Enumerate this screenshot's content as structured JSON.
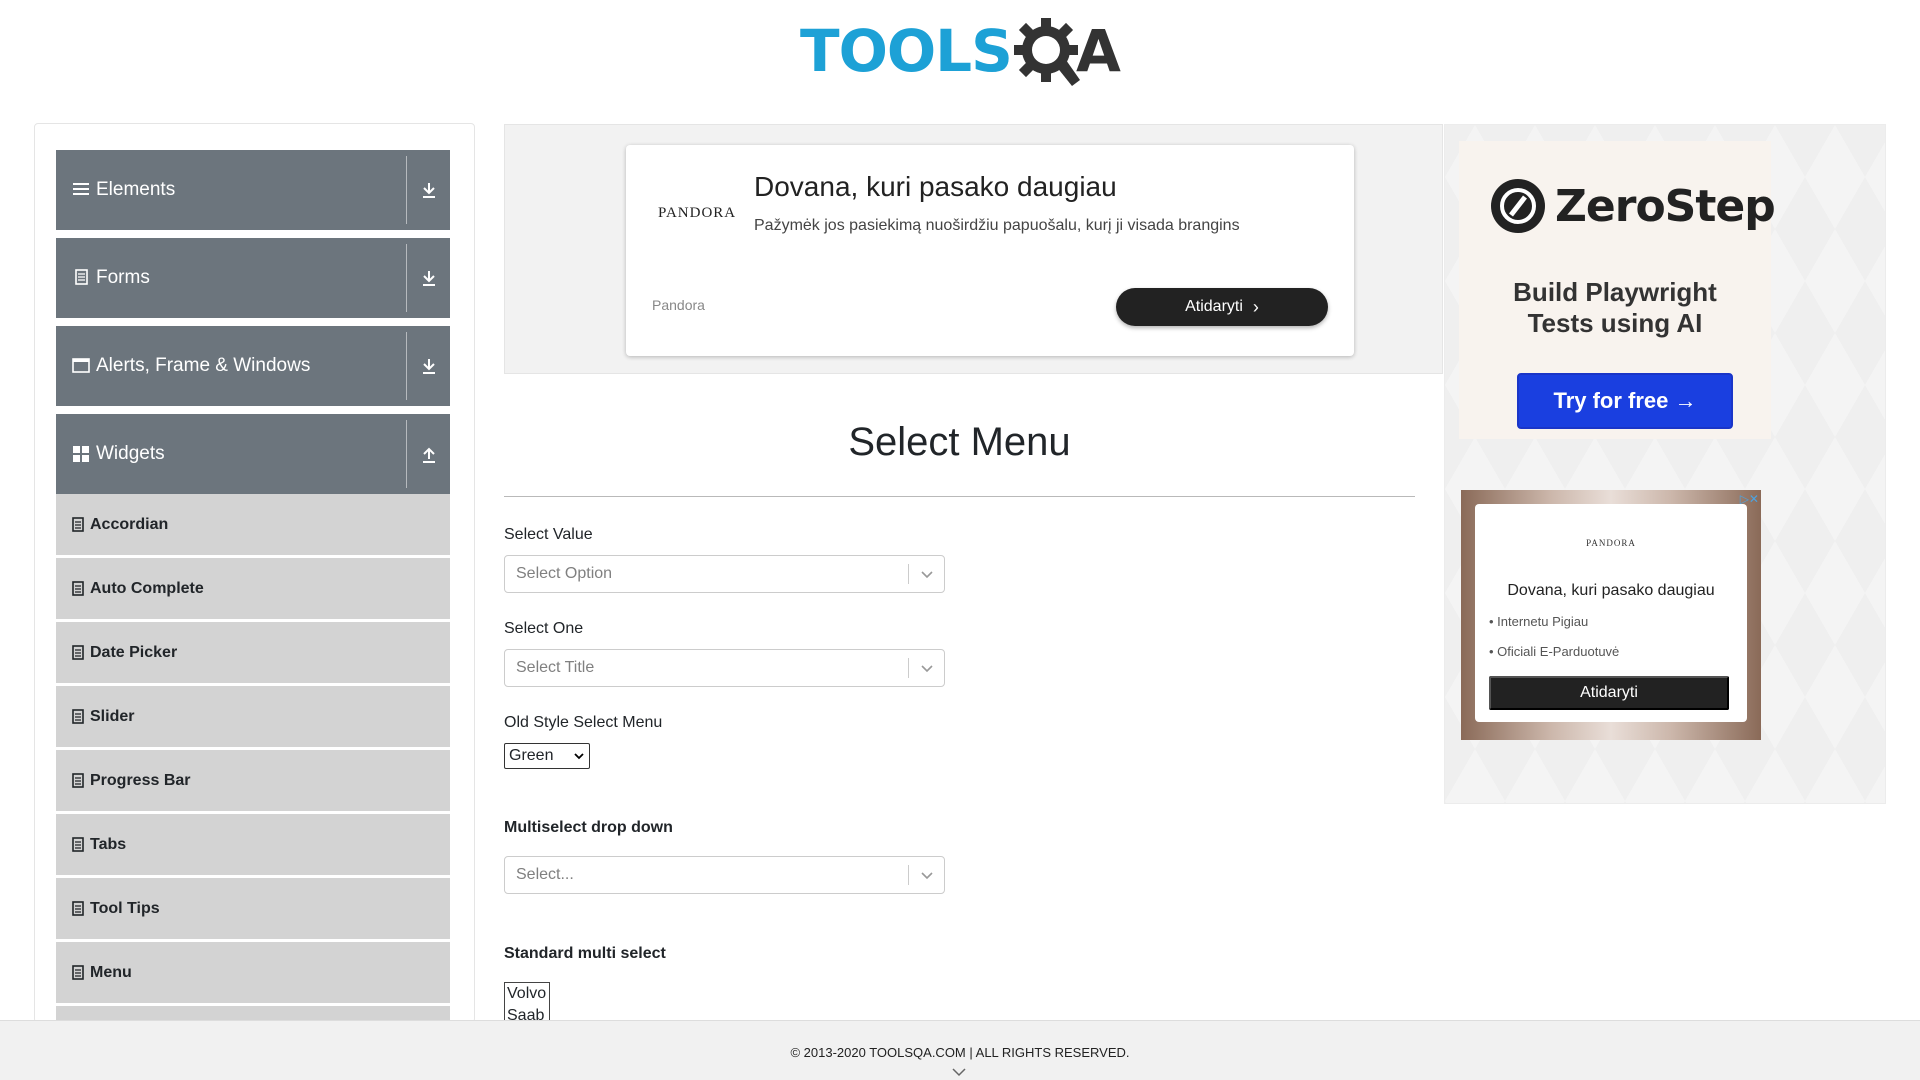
{
  "logo": {
    "text": "TOOLS",
    "suffix": "A"
  },
  "sidebar": {
    "groups": [
      {
        "label": "Elements",
        "icon": "hamburger-icon",
        "expanded": false
      },
      {
        "label": "Forms",
        "icon": "document-icon",
        "expanded": false
      },
      {
        "label": "Alerts, Frame & Windows",
        "icon": "window-icon",
        "expanded": false
      },
      {
        "label": "Widgets",
        "icon": "grid-icon",
        "expanded": true
      }
    ],
    "items": [
      "Accordian",
      "Auto Complete",
      "Date Picker",
      "Slider",
      "Progress Bar",
      "Tabs",
      "Tool Tips",
      "Menu"
    ]
  },
  "top_ad": {
    "brand_logo": "PANDORA",
    "title": "Dovana, kuri pasako daugiau",
    "description": "Pažymėk jos pasiekimą nuoširdžiu papuošalu, kurį ji visada brangins",
    "brand": "Pandora",
    "cta": "Atidaryti"
  },
  "main": {
    "title": "Select Menu",
    "select_value": {
      "label": "Select Value",
      "placeholder": "Select Option"
    },
    "select_one": {
      "label": "Select One",
      "placeholder": "Select Title"
    },
    "old_style": {
      "label": "Old Style Select Menu",
      "value": "Green"
    },
    "multiselect": {
      "label": "Multiselect drop down",
      "placeholder": "Select..."
    },
    "standard_multi": {
      "label": "Standard multi select",
      "options": [
        "Volvo",
        "Saab"
      ]
    }
  },
  "right_ad_1": {
    "name": "ZeroStep",
    "tagline_1": "Build Playwright",
    "tagline_2": "Tests using AI",
    "cta": "Try for free →"
  },
  "right_ad_2": {
    "brand_logo": "PANDORA",
    "title": "Dovana, kuri pasako daugiau",
    "bullet_1": "• Internetu Pigiau",
    "bullet_2": "• Oficiali E-Parduotuvė",
    "cta": "Atidaryti",
    "badge": "▷✕"
  },
  "footer": {
    "text": "© 2013-2020 TOOLSQA.COM | ALL RIGHTS RESERVED."
  },
  "colors": {
    "accent": "#1da1d6",
    "sidebar_header": "#6c757d",
    "sidebar_item": "#d3d3d3"
  }
}
